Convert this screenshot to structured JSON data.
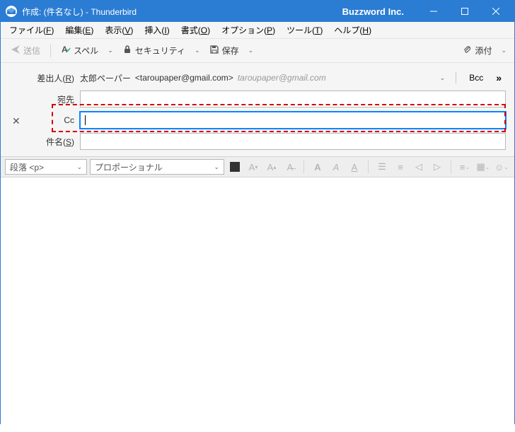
{
  "title": "作成: (件名なし) - Thunderbird",
  "brand": "Buzzword Inc.",
  "menu": {
    "file": "ファイル(F)",
    "edit": "編集(E)",
    "view": "表示(V)",
    "insert": "挿入(I)",
    "format": "書式(O)",
    "options": "オプション(P)",
    "tools": "ツール(T)",
    "help": "ヘルプ(H)"
  },
  "toolbar": {
    "send": "送信",
    "spell": "スペル",
    "security": "セキュリティ",
    "save": "保存",
    "attach": "添付"
  },
  "headers": {
    "from_label": "差出人(R)",
    "from_name": "太郎ペーパー",
    "from_email": "<taroupaper@gmail.com>",
    "from_email_gray": "taroupaper@gmail.com",
    "to_label": "宛先",
    "cc_label": "Cc",
    "bcc_button": "Bcc",
    "subject_label": "件名(S)"
  },
  "format": {
    "para": "段落 <p>",
    "font": "プロポーショナル"
  }
}
